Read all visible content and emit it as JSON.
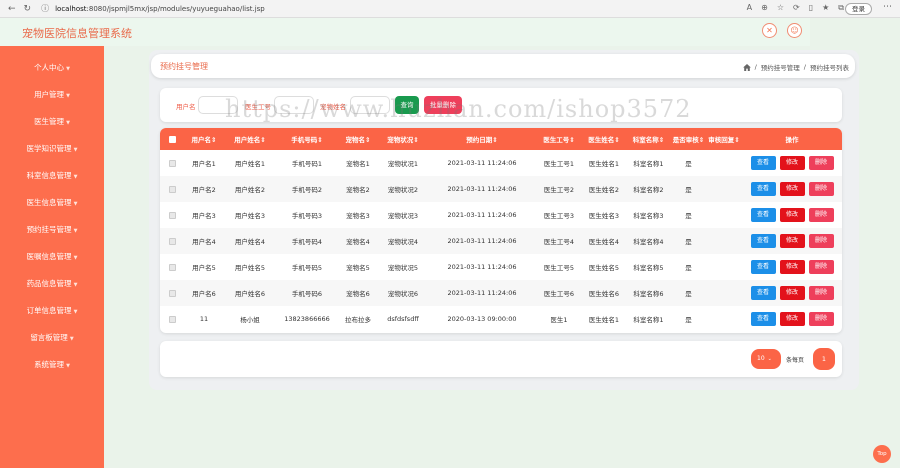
{
  "browser": {
    "url_host": "localhost",
    "url_path": ":8080/jspmjl5mx/jsp/modules/yuyueguahao/list.jsp",
    "login_label": "登录"
  },
  "header": {
    "title": "宠物医院信息管理系统"
  },
  "sidebar": {
    "items": [
      {
        "label": "个人中心"
      },
      {
        "label": "用户管理"
      },
      {
        "label": "医生管理"
      },
      {
        "label": "医学知识管理"
      },
      {
        "label": "科室信息管理"
      },
      {
        "label": "医生信息管理"
      },
      {
        "label": "预约挂号管理"
      },
      {
        "label": "医嘱信息管理"
      },
      {
        "label": "药品信息管理"
      },
      {
        "label": "订单信息管理"
      },
      {
        "label": "留言板管理"
      },
      {
        "label": "系统管理"
      }
    ]
  },
  "breadcrumb": {
    "page_title": "预约挂号管理",
    "crumb1": "预约挂号管理",
    "sep": "/",
    "crumb2": "预约挂号列表"
  },
  "search": {
    "username_label": "用户名",
    "doctor_id_label": "医生工号",
    "pet_name_label": "宠物姓名",
    "query_button": "查询",
    "batch_delete_button": "批量删除"
  },
  "table": {
    "headers": [
      "用户名",
      "用户姓名",
      "手机号码",
      "宠物名",
      "宠物状况",
      "预约日期",
      "医生工号",
      "医生姓名",
      "科室名称",
      "是否审核",
      "审核回复",
      "操作"
    ],
    "rows": [
      {
        "username": "用户名1",
        "name": "用户姓名1",
        "phone": "手机号码1",
        "pet": "宠物名1",
        "status": "宠物状况1",
        "date": "2021-03-11 11:24:06",
        "doc_id": "医生工号1",
        "doc_name": "医生姓名1",
        "dept": "科室名称1",
        "audit": "是",
        "reply": ""
      },
      {
        "username": "用户名2",
        "name": "用户姓名2",
        "phone": "手机号码2",
        "pet": "宠物名2",
        "status": "宠物状况2",
        "date": "2021-03-11 11:24:06",
        "doc_id": "医生工号2",
        "doc_name": "医生姓名2",
        "dept": "科室名称2",
        "audit": "是",
        "reply": ""
      },
      {
        "username": "用户名3",
        "name": "用户姓名3",
        "phone": "手机号码3",
        "pet": "宠物名3",
        "status": "宠物状况3",
        "date": "2021-03-11 11:24:06",
        "doc_id": "医生工号3",
        "doc_name": "医生姓名3",
        "dept": "科室名称3",
        "audit": "是",
        "reply": ""
      },
      {
        "username": "用户名4",
        "name": "用户姓名4",
        "phone": "手机号码4",
        "pet": "宠物名4",
        "status": "宠物状况4",
        "date": "2021-03-11 11:24:06",
        "doc_id": "医生工号4",
        "doc_name": "医生姓名4",
        "dept": "科室名称4",
        "audit": "是",
        "reply": ""
      },
      {
        "username": "用户名5",
        "name": "用户姓名5",
        "phone": "手机号码5",
        "pet": "宠物名5",
        "status": "宠物状况5",
        "date": "2021-03-11 11:24:06",
        "doc_id": "医生工号5",
        "doc_name": "医生姓名5",
        "dept": "科室名称5",
        "audit": "是",
        "reply": ""
      },
      {
        "username": "用户名6",
        "name": "用户姓名6",
        "phone": "手机号码6",
        "pet": "宠物名6",
        "status": "宠物状况6",
        "date": "2021-03-11 11:24:06",
        "doc_id": "医生工号6",
        "doc_name": "医生姓名6",
        "dept": "科室名称6",
        "audit": "是",
        "reply": ""
      },
      {
        "username": "11",
        "name": "杨小姐",
        "phone": "13823866666",
        "pet": "拉布拉多",
        "status": "dsfdsfsdff",
        "date": "2020-03-13 09:00:00",
        "doc_id": "医生1",
        "doc_name": "医生姓名1",
        "dept": "科室名称1",
        "audit": "是",
        "reply": ""
      }
    ],
    "actions": {
      "view": "查看",
      "edit": "修改",
      "delete": "删除"
    }
  },
  "pagination": {
    "page_size": "10",
    "page_size_label": "条每页",
    "current_page": "1"
  },
  "watermark": "https://www.huzhan.com/ishop3572",
  "top_button": "Top",
  "colors": {
    "primary": "#fd6e4d",
    "header_bg": "#fb6446",
    "view": "#1c8fe8",
    "edit": "#e3121b",
    "delete": "#ee3f5b"
  }
}
